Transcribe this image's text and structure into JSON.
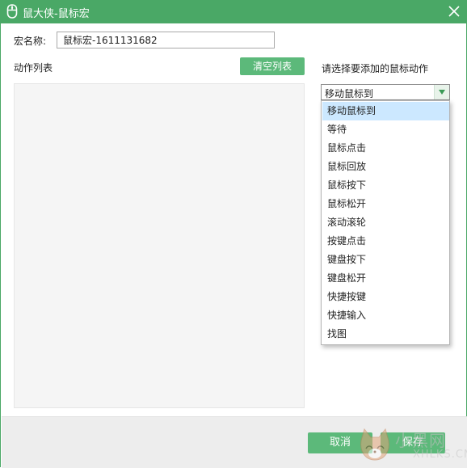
{
  "window": {
    "title": "鼠大侠-鼠标宏",
    "theme_color": "#4aa866"
  },
  "form": {
    "name_label": "宏名称:",
    "name_value": "鼠标宏-1611131682"
  },
  "left_panel": {
    "title": "动作列表",
    "clear_button": "清空列表",
    "items": []
  },
  "right_panel": {
    "title": "请选择要添加的鼠标动作",
    "selected": "移动鼠标到",
    "options": [
      "移动鼠标到",
      "等待",
      "鼠标点击",
      "鼠标回放",
      "鼠标按下",
      "鼠标松开",
      "滚动滚轮",
      "按键点击",
      "键盘按下",
      "键盘松开",
      "快捷按键",
      "快捷输入",
      "找图"
    ],
    "highlighted_index": 0
  },
  "footer": {
    "cancel_label": "取消",
    "save_label": "保存",
    "button_color": "#5cb97a"
  },
  "watermark": {
    "text": "小黑网",
    "sub": "XHLKS.CN"
  }
}
